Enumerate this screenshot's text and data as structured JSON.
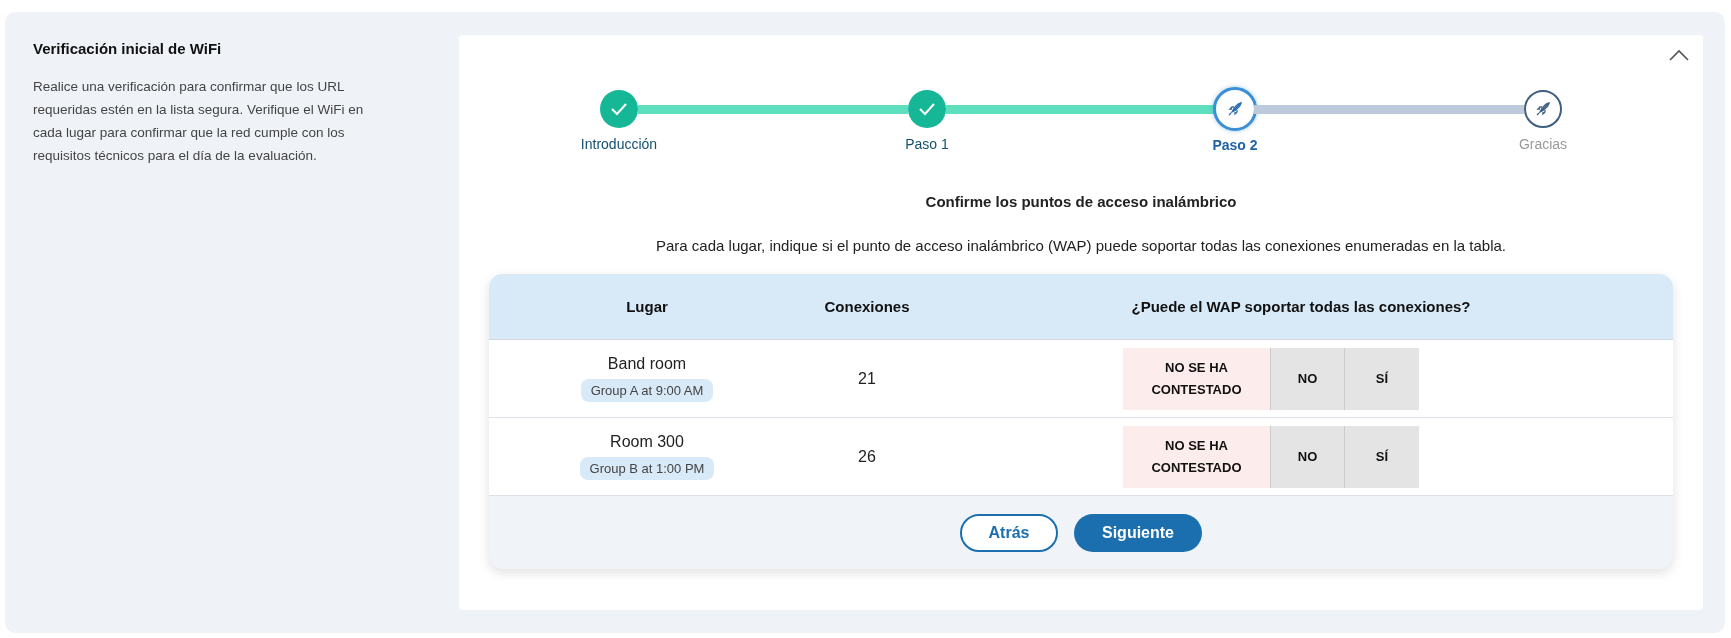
{
  "sidebar": {
    "title": "Verificación inicial de WiFi",
    "description": "Realice una verificación para confirmar que los URL requeridas estén en la lista segura. Verifique el WiFi en cada lugar para confirmar que la red cumple con los requisitos técnicos para el día de la evaluación."
  },
  "stepper": [
    {
      "label": "Introducción",
      "completed": true,
      "current": false
    },
    {
      "label": "Paso 1",
      "completed": true,
      "current": false
    },
    {
      "label": "Paso 2",
      "completed": false,
      "current": true
    },
    {
      "label": "Gracias",
      "completed": false,
      "current": false
    }
  ],
  "heading": "Confirme los puntos de acceso inalámbrico",
  "instructions": "Para cada lugar, indique si el punto de acceso inalámbrico (WAP) puede soportar todas las conexiones enumeradas en la tabla.",
  "table": {
    "columns": [
      "Lugar",
      "Conexiones",
      "¿Puede el WAP soportar todas las conexiones?"
    ],
    "rows": [
      {
        "place": "Band room",
        "group": "Group A at 9:00 AM",
        "connections": "21",
        "options": [
          {
            "label": "NO SE HA CONTESTADO",
            "selected": true
          },
          {
            "label": "NO",
            "selected": false
          },
          {
            "label": "SÍ",
            "selected": false
          }
        ]
      },
      {
        "place": "Room 300",
        "group": "Group B at 1:00 PM",
        "connections": "26",
        "options": [
          {
            "label": "NO SE HA CONTESTADO",
            "selected": true
          },
          {
            "label": "NO",
            "selected": false
          },
          {
            "label": "SÍ",
            "selected": false
          }
        ]
      }
    ]
  },
  "buttons": [
    {
      "label": "Atrás",
      "kind": "secondary"
    },
    {
      "label": "Siguiente",
      "kind": "primary"
    }
  ]
}
